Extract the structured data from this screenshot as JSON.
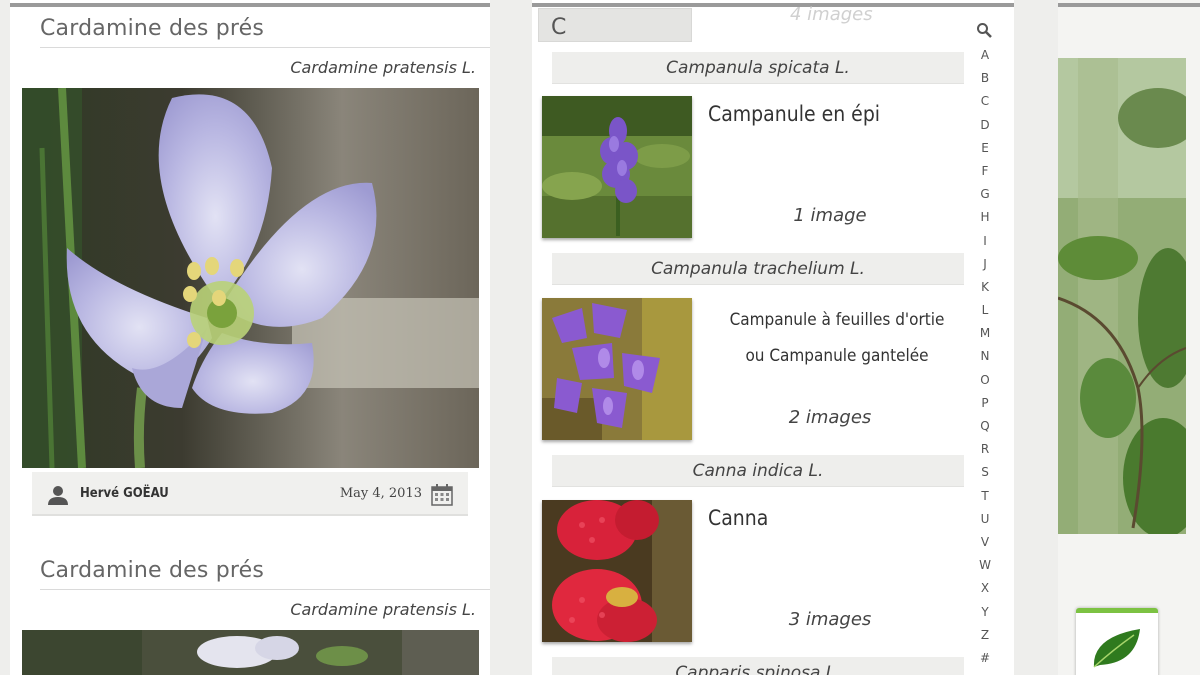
{
  "left_panel": {
    "observations": [
      {
        "common_name": "Cardamine des prés",
        "scientific_name": "Cardamine pratensis L.",
        "author": "Hervé GOËAU",
        "date": "May 4, 2013"
      },
      {
        "common_name": "Cardamine des prés",
        "scientific_name": "Cardamine pratensis L."
      }
    ]
  },
  "middle_panel": {
    "search": {
      "value": "C",
      "count_hint": "4 images"
    },
    "species": [
      {
        "scientific_name": "Campanula spicata L.",
        "common_name": "Campanule en épi",
        "image_count": "1 image"
      },
      {
        "scientific_name": "Campanula trachelium L.",
        "common_name_line1": "Campanule à feuilles d'ortie",
        "common_name_line2": "ou Campanule gantelée",
        "image_count": "2 images"
      },
      {
        "scientific_name": "Canna indica L.",
        "common_name": "Canna",
        "image_count": "3 images"
      },
      {
        "scientific_name": "Capparis spinosa L."
      }
    ],
    "alphabet": [
      "A",
      "B",
      "C",
      "D",
      "E",
      "F",
      "G",
      "H",
      "I",
      "J",
      "K",
      "L",
      "M",
      "N",
      "O",
      "P",
      "Q",
      "R",
      "S",
      "T",
      "U",
      "V",
      "W",
      "X",
      "Y",
      "Z",
      "#"
    ]
  },
  "icons": {
    "user": "user-icon",
    "calendar": "calendar-icon",
    "search": "search-icon",
    "leaf": "leaf-icon"
  },
  "colors": {
    "accent_green": "#7cc242",
    "header_bg": "#eeeeec",
    "top_bar": "#9a9a9a"
  }
}
